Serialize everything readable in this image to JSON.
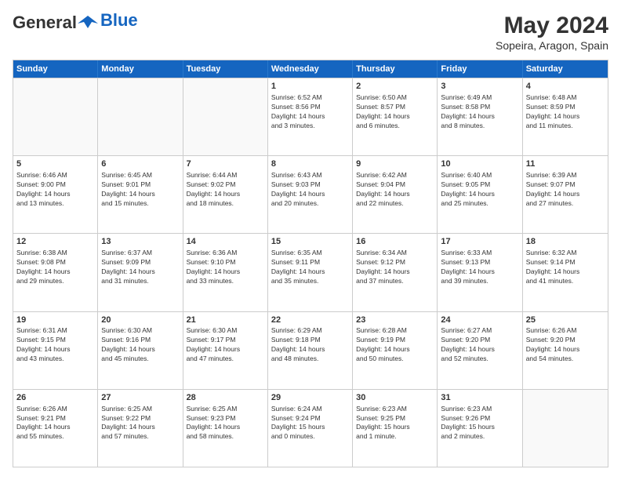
{
  "header": {
    "logo_general": "General",
    "logo_blue": "Blue",
    "month_title": "May 2024",
    "location": "Sopeira, Aragon, Spain"
  },
  "days_of_week": [
    "Sunday",
    "Monday",
    "Tuesday",
    "Wednesday",
    "Thursday",
    "Friday",
    "Saturday"
  ],
  "weeks": [
    [
      {
        "day": "",
        "info": "",
        "empty": true
      },
      {
        "day": "",
        "info": "",
        "empty": true
      },
      {
        "day": "",
        "info": "",
        "empty": true
      },
      {
        "day": "1",
        "info": "Sunrise: 6:52 AM\nSunset: 8:56 PM\nDaylight: 14 hours\nand 3 minutes.",
        "empty": false
      },
      {
        "day": "2",
        "info": "Sunrise: 6:50 AM\nSunset: 8:57 PM\nDaylight: 14 hours\nand 6 minutes.",
        "empty": false
      },
      {
        "day": "3",
        "info": "Sunrise: 6:49 AM\nSunset: 8:58 PM\nDaylight: 14 hours\nand 8 minutes.",
        "empty": false
      },
      {
        "day": "4",
        "info": "Sunrise: 6:48 AM\nSunset: 8:59 PM\nDaylight: 14 hours\nand 11 minutes.",
        "empty": false
      }
    ],
    [
      {
        "day": "5",
        "info": "Sunrise: 6:46 AM\nSunset: 9:00 PM\nDaylight: 14 hours\nand 13 minutes.",
        "empty": false
      },
      {
        "day": "6",
        "info": "Sunrise: 6:45 AM\nSunset: 9:01 PM\nDaylight: 14 hours\nand 15 minutes.",
        "empty": false
      },
      {
        "day": "7",
        "info": "Sunrise: 6:44 AM\nSunset: 9:02 PM\nDaylight: 14 hours\nand 18 minutes.",
        "empty": false
      },
      {
        "day": "8",
        "info": "Sunrise: 6:43 AM\nSunset: 9:03 PM\nDaylight: 14 hours\nand 20 minutes.",
        "empty": false
      },
      {
        "day": "9",
        "info": "Sunrise: 6:42 AM\nSunset: 9:04 PM\nDaylight: 14 hours\nand 22 minutes.",
        "empty": false
      },
      {
        "day": "10",
        "info": "Sunrise: 6:40 AM\nSunset: 9:05 PM\nDaylight: 14 hours\nand 25 minutes.",
        "empty": false
      },
      {
        "day": "11",
        "info": "Sunrise: 6:39 AM\nSunset: 9:07 PM\nDaylight: 14 hours\nand 27 minutes.",
        "empty": false
      }
    ],
    [
      {
        "day": "12",
        "info": "Sunrise: 6:38 AM\nSunset: 9:08 PM\nDaylight: 14 hours\nand 29 minutes.",
        "empty": false
      },
      {
        "day": "13",
        "info": "Sunrise: 6:37 AM\nSunset: 9:09 PM\nDaylight: 14 hours\nand 31 minutes.",
        "empty": false
      },
      {
        "day": "14",
        "info": "Sunrise: 6:36 AM\nSunset: 9:10 PM\nDaylight: 14 hours\nand 33 minutes.",
        "empty": false
      },
      {
        "day": "15",
        "info": "Sunrise: 6:35 AM\nSunset: 9:11 PM\nDaylight: 14 hours\nand 35 minutes.",
        "empty": false
      },
      {
        "day": "16",
        "info": "Sunrise: 6:34 AM\nSunset: 9:12 PM\nDaylight: 14 hours\nand 37 minutes.",
        "empty": false
      },
      {
        "day": "17",
        "info": "Sunrise: 6:33 AM\nSunset: 9:13 PM\nDaylight: 14 hours\nand 39 minutes.",
        "empty": false
      },
      {
        "day": "18",
        "info": "Sunrise: 6:32 AM\nSunset: 9:14 PM\nDaylight: 14 hours\nand 41 minutes.",
        "empty": false
      }
    ],
    [
      {
        "day": "19",
        "info": "Sunrise: 6:31 AM\nSunset: 9:15 PM\nDaylight: 14 hours\nand 43 minutes.",
        "empty": false
      },
      {
        "day": "20",
        "info": "Sunrise: 6:30 AM\nSunset: 9:16 PM\nDaylight: 14 hours\nand 45 minutes.",
        "empty": false
      },
      {
        "day": "21",
        "info": "Sunrise: 6:30 AM\nSunset: 9:17 PM\nDaylight: 14 hours\nand 47 minutes.",
        "empty": false
      },
      {
        "day": "22",
        "info": "Sunrise: 6:29 AM\nSunset: 9:18 PM\nDaylight: 14 hours\nand 48 minutes.",
        "empty": false
      },
      {
        "day": "23",
        "info": "Sunrise: 6:28 AM\nSunset: 9:19 PM\nDaylight: 14 hours\nand 50 minutes.",
        "empty": false
      },
      {
        "day": "24",
        "info": "Sunrise: 6:27 AM\nSunset: 9:20 PM\nDaylight: 14 hours\nand 52 minutes.",
        "empty": false
      },
      {
        "day": "25",
        "info": "Sunrise: 6:26 AM\nSunset: 9:20 PM\nDaylight: 14 hours\nand 54 minutes.",
        "empty": false
      }
    ],
    [
      {
        "day": "26",
        "info": "Sunrise: 6:26 AM\nSunset: 9:21 PM\nDaylight: 14 hours\nand 55 minutes.",
        "empty": false
      },
      {
        "day": "27",
        "info": "Sunrise: 6:25 AM\nSunset: 9:22 PM\nDaylight: 14 hours\nand 57 minutes.",
        "empty": false
      },
      {
        "day": "28",
        "info": "Sunrise: 6:25 AM\nSunset: 9:23 PM\nDaylight: 14 hours\nand 58 minutes.",
        "empty": false
      },
      {
        "day": "29",
        "info": "Sunrise: 6:24 AM\nSunset: 9:24 PM\nDaylight: 15 hours\nand 0 minutes.",
        "empty": false
      },
      {
        "day": "30",
        "info": "Sunrise: 6:23 AM\nSunset: 9:25 PM\nDaylight: 15 hours\nand 1 minute.",
        "empty": false
      },
      {
        "day": "31",
        "info": "Sunrise: 6:23 AM\nSunset: 9:26 PM\nDaylight: 15 hours\nand 2 minutes.",
        "empty": false
      },
      {
        "day": "",
        "info": "",
        "empty": true
      }
    ]
  ]
}
